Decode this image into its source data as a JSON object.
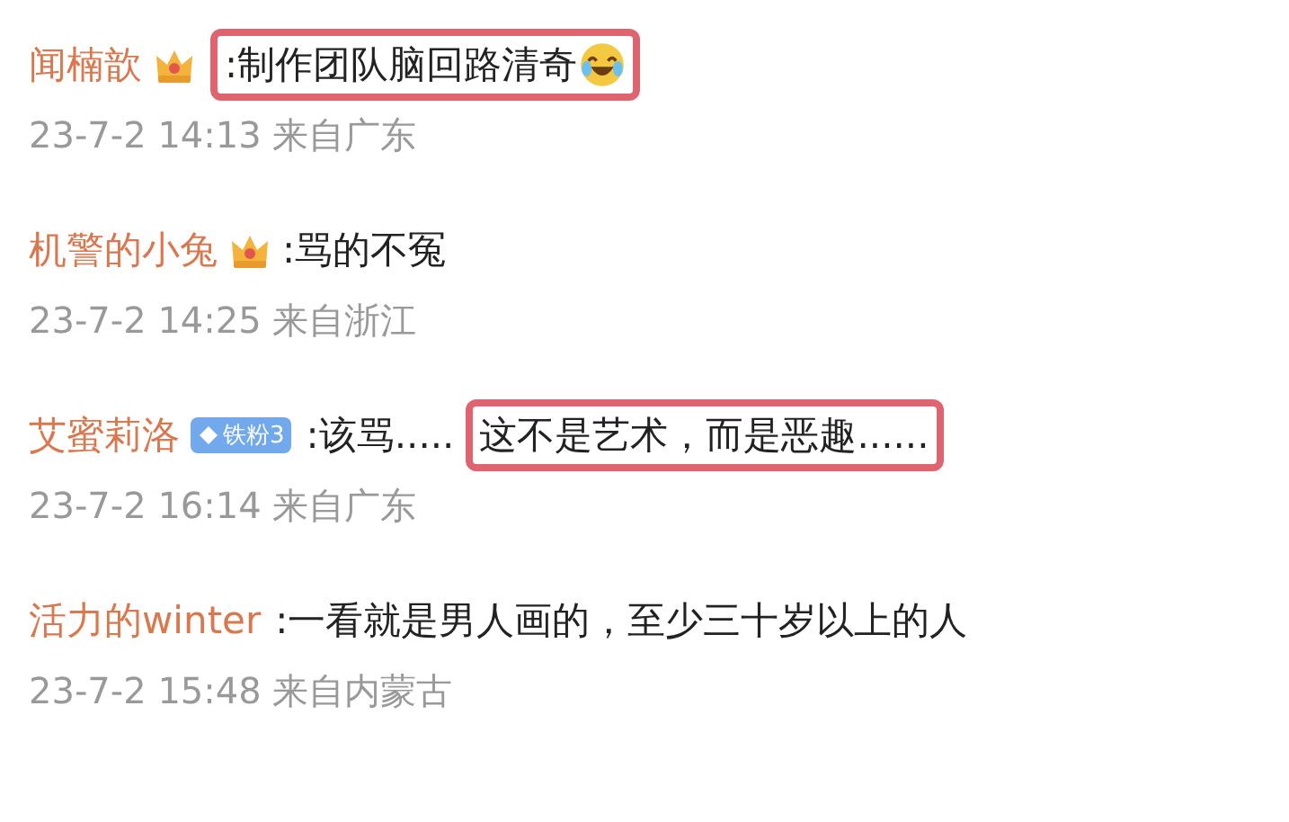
{
  "comments": [
    {
      "user": "闻楠歆",
      "badge": {
        "kind": "crown"
      },
      "segments": [
        {
          "text": ":制作团队脑回路清奇",
          "highlighted": true,
          "emoji": true
        }
      ],
      "meta": "23-7-2 14:13 来自广东"
    },
    {
      "user": "机警的小兔",
      "badge": {
        "kind": "crown"
      },
      "segments": [
        {
          "text": ":骂的不冤",
          "highlighted": false,
          "emoji": false
        }
      ],
      "meta": "23-7-2 14:25 来自浙江"
    },
    {
      "user": "艾蜜莉洛",
      "badge": {
        "kind": "fan",
        "label": "铁粉3"
      },
      "segments": [
        {
          "text": ":该骂.....",
          "highlighted": false,
          "emoji": false
        },
        {
          "text": "这不是艺术，而是恶趣......",
          "highlighted": true,
          "emoji": false
        }
      ],
      "meta": "23-7-2 16:14 来自广东"
    },
    {
      "user": "活力的winter",
      "segments": [
        {
          "text": ":一看就是男人画的，至少三十岁以上的人",
          "highlighted": false,
          "emoji": false
        }
      ],
      "meta": "23-7-2 15:48 来自内蒙古"
    }
  ]
}
